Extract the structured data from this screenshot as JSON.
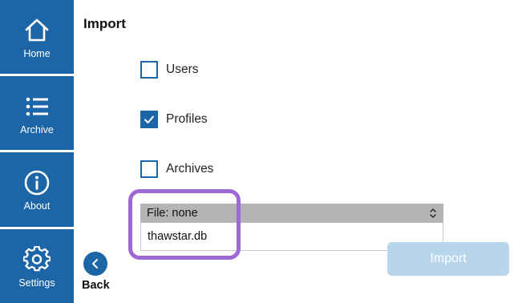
{
  "sidebar": {
    "items": [
      {
        "label": "Home",
        "icon": "home-icon"
      },
      {
        "label": "Archive",
        "icon": "list-icon"
      },
      {
        "label": "About",
        "icon": "info-icon"
      },
      {
        "label": "Settings",
        "icon": "gear-icon"
      }
    ]
  },
  "page": {
    "title": "Import"
  },
  "options": [
    {
      "label": "Users",
      "checked": false
    },
    {
      "label": "Profiles",
      "checked": true
    },
    {
      "label": "Archives",
      "checked": false
    }
  ],
  "file_select": {
    "selected": "File: none",
    "options": [
      "thawstar.db"
    ]
  },
  "buttons": {
    "import": "Import",
    "back": "Back"
  },
  "colors": {
    "accent": "#1c66a7",
    "highlight": "#9d68d4",
    "import_disabled": "#b7d6ec"
  }
}
